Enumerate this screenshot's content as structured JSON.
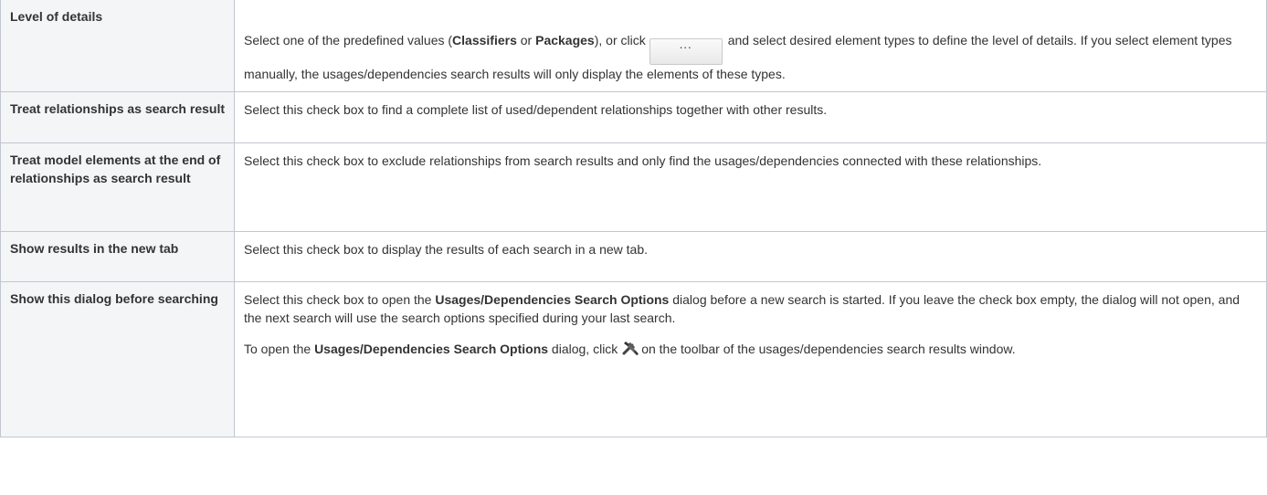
{
  "rows": [
    {
      "name": "Level of details",
      "desc": {
        "t1": "Select one of the predefined values (",
        "b1": "Classifiers",
        "t2": " or ",
        "b2": "Packages",
        "t3": "), or click",
        "button_label": "...",
        "t4": "and select desired element types to define the level of details. If you select element types manually, the usages/dependencies search results will only display the elements of these types."
      }
    },
    {
      "name": "Treat relationships as search result",
      "desc": "Select this check box to find a complete list of used/dependent relationships together with other results."
    },
    {
      "name": "Treat model elements at the end of relationships as search result",
      "desc": "Select this check box to exclude relationships from search results and only find the usages/dependencies connected with these relationships."
    },
    {
      "name": "Show results in the new tab",
      "desc": "Select this check box to display the results of each search in a new tab."
    },
    {
      "name": "Show this dialog before searching",
      "desc_p1": {
        "t1": "Select this check box to open the ",
        "b1": "Usages/Dependencies Search Options",
        "t2": " dialog before a new search is started. If you leave the check box empty, the dialog will not open, and the next search will use the search options specified during your last search."
      },
      "desc_p2": {
        "t1": "To open the ",
        "b1": "Usages/Dependencies Search Options",
        "t2": " dialog, click",
        "icon": "tools-icon",
        "t3": "on the toolbar of the usages/dependencies search results window."
      }
    }
  ]
}
